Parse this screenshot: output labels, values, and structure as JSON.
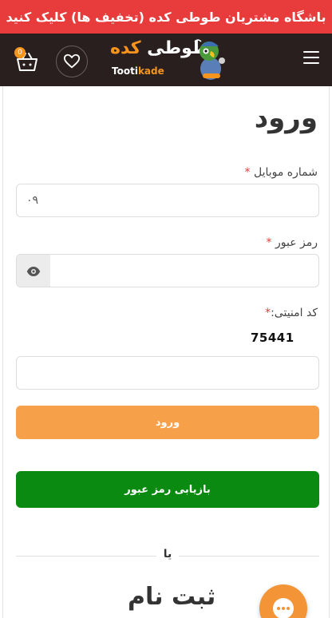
{
  "promo": {
    "text": "باشگاه مشتریان طوطی کده (تخفیف ها) کلیک کنید"
  },
  "header": {
    "brand_word_main": "طوطی",
    "brand_word_accent": "کده",
    "brand_latin_main": "Tooti",
    "brand_latin_accent": "kade",
    "cart_count": "0",
    "icons": {
      "menu": "menu-icon",
      "wishlist": "heart-icon",
      "cart": "basket-icon"
    }
  },
  "login": {
    "title": "ورود",
    "mobile_label": "شماره موبایل",
    "mobile_value": "۰۹",
    "password_label": "رمز عبور",
    "captcha_label": "کد امنیتی:",
    "required_mark": "*",
    "captcha_code": "75441",
    "login_button": "ورود",
    "recover_button": "بازیابی رمز عبور"
  },
  "or_text": "یا",
  "register": {
    "title": "ثبت نام"
  },
  "colors": {
    "promo_bg": "#e83c3c",
    "header_bg": "#2a1f1f",
    "accent": "#f7941d",
    "login_btn": "#f7a04a",
    "recover_btn": "#0b8a12"
  }
}
